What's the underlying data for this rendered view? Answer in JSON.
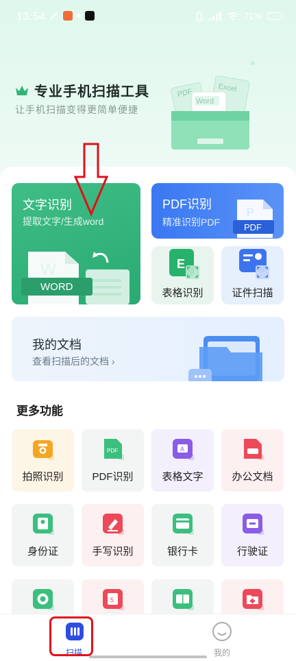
{
  "status_bar": {
    "time": "13:54",
    "battery": "71%"
  },
  "hero": {
    "title": "专业手机扫描工具",
    "subtitle": "让手机扫描变得更简单便捷",
    "illus_labels": {
      "pdf": "PDF",
      "excel": "Excel",
      "word": "Word"
    }
  },
  "cards": {
    "text_recog": {
      "title": "文字识别",
      "subtitle": "提取文字/生成word",
      "badge": "WORD",
      "badge_letter": "W"
    },
    "pdf_recog": {
      "title": "PDF识别",
      "subtitle": "精准识别PDF",
      "badge": "PDF"
    },
    "table_recog": {
      "label": "表格识别",
      "icon_letter": "E"
    },
    "id_scan": {
      "label": "证件扫描"
    }
  },
  "docs": {
    "title": "我的文档",
    "subtitle": "查看扫描后的文档 ›"
  },
  "more": {
    "title": "更多功能",
    "items": [
      {
        "label": "拍照识别",
        "icon": "camera-icon",
        "bg": "#fdf6e6",
        "color": "#f5a623"
      },
      {
        "label": "PDF识别",
        "icon": "pdf-file-icon",
        "bg": "#f3f5f4",
        "color": "#3cbf7e"
      },
      {
        "label": "表格文字",
        "icon": "table-text-icon",
        "bg": "#f3effc",
        "color": "#8b5ce6"
      },
      {
        "label": "办公文档",
        "icon": "office-doc-icon",
        "bg": "#fdf0f1",
        "color": "#ec4a5a"
      },
      {
        "label": "身份证",
        "icon": "id-card-icon",
        "bg": "#f3f5f4",
        "color": "#3cbf7e"
      },
      {
        "label": "手写识别",
        "icon": "handwriting-icon",
        "bg": "#fdf0f1",
        "color": "#ec4a5a"
      },
      {
        "label": "银行卡",
        "icon": "bank-card-icon",
        "bg": "#f3f5f4",
        "color": "#3cbf7e"
      },
      {
        "label": "行驶证",
        "icon": "driving-license-icon",
        "bg": "#f3effc",
        "color": "#8b5ce6"
      },
      {
        "label": "",
        "icon": "target-icon",
        "bg": "#f3f5f4",
        "color": "#3cbf7e"
      },
      {
        "label": "",
        "icon": "number-card-icon",
        "bg": "#fdf0f1",
        "color": "#ec4a5a"
      },
      {
        "label": "",
        "icon": "split-icon",
        "bg": "#f3f5f4",
        "color": "#3cbf7e"
      },
      {
        "label": "",
        "icon": "folder-plus-icon",
        "bg": "#fdf0f1",
        "color": "#ec4a5a"
      }
    ]
  },
  "nav": {
    "scan": "扫描",
    "mine": "我的",
    "active_color": "#2f4de0"
  }
}
